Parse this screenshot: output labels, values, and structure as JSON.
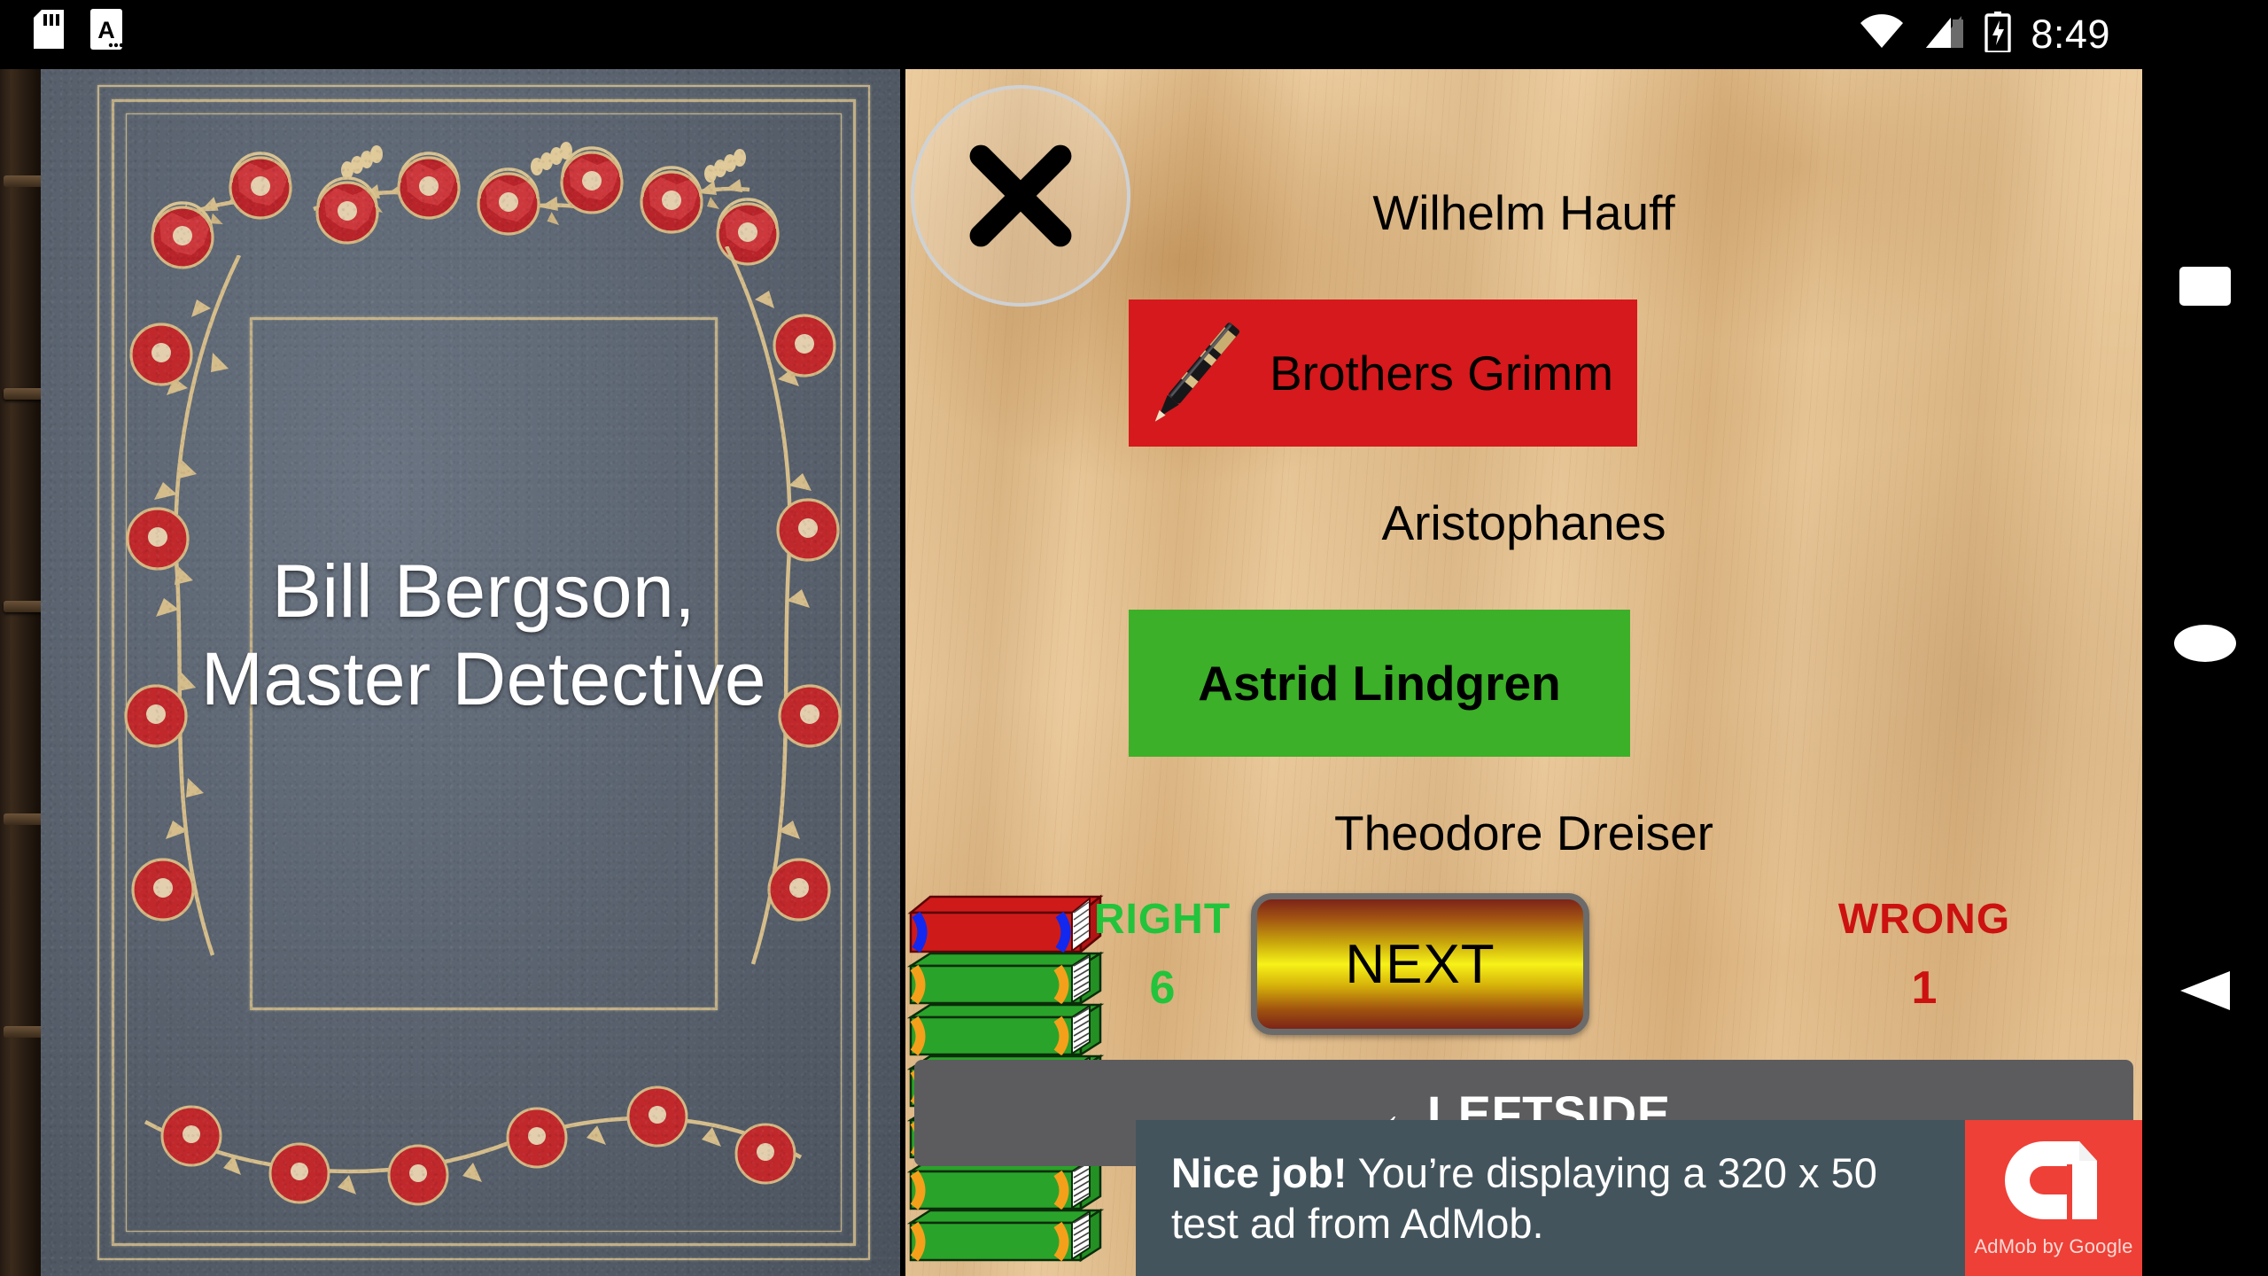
{
  "status_bar": {
    "icons": [
      "sd-card-icon",
      "document-a-icon",
      "wifi-icon",
      "cellular-signal-icon",
      "battery-charging-icon"
    ],
    "time": "8:49"
  },
  "book_cover": {
    "title": "Bill Bergson, Master Detective",
    "cover_color": "#5b6470",
    "ornament_gold": "#d6be8c",
    "flower_color": "#c0282c"
  },
  "quiz": {
    "close_label": "close-icon",
    "answers": [
      {
        "label": "Wilhelm Hauff",
        "state": "plain",
        "icon": null
      },
      {
        "label": "Brothers Grimm",
        "state": "wrong",
        "icon": "pen-icon",
        "color": "#d5191c"
      },
      {
        "label": "Aristophanes",
        "state": "plain",
        "icon": null
      },
      {
        "label": "Astrid Lindgren",
        "state": "correct",
        "icon": null,
        "color": "#3cb028"
      },
      {
        "label": "Theodore Dreiser",
        "state": "plain",
        "icon": null
      }
    ],
    "score": {
      "right_label": "RIGHT",
      "right_value": "6",
      "right_color": "#22c43b",
      "wrong_label": "WRONG",
      "wrong_value": "1",
      "wrong_color": "#cc1111"
    },
    "next_label": "NEXT",
    "leftside_label": "←LEFTSIDE",
    "book_stack": {
      "red_books": 1,
      "green_books": 6
    }
  },
  "ad": {
    "headline": "Nice job!",
    "body": " You’re displaying a 320 x 50 test ad from AdMob.",
    "logo_caption": "AdMob by Google",
    "logo_color": "#ee4037",
    "bg_color": "#44545c"
  },
  "nav_bar": {
    "recents_label": "recents-square-icon",
    "home_label": "home-circle-icon",
    "back_label": "back-triangle-icon"
  }
}
